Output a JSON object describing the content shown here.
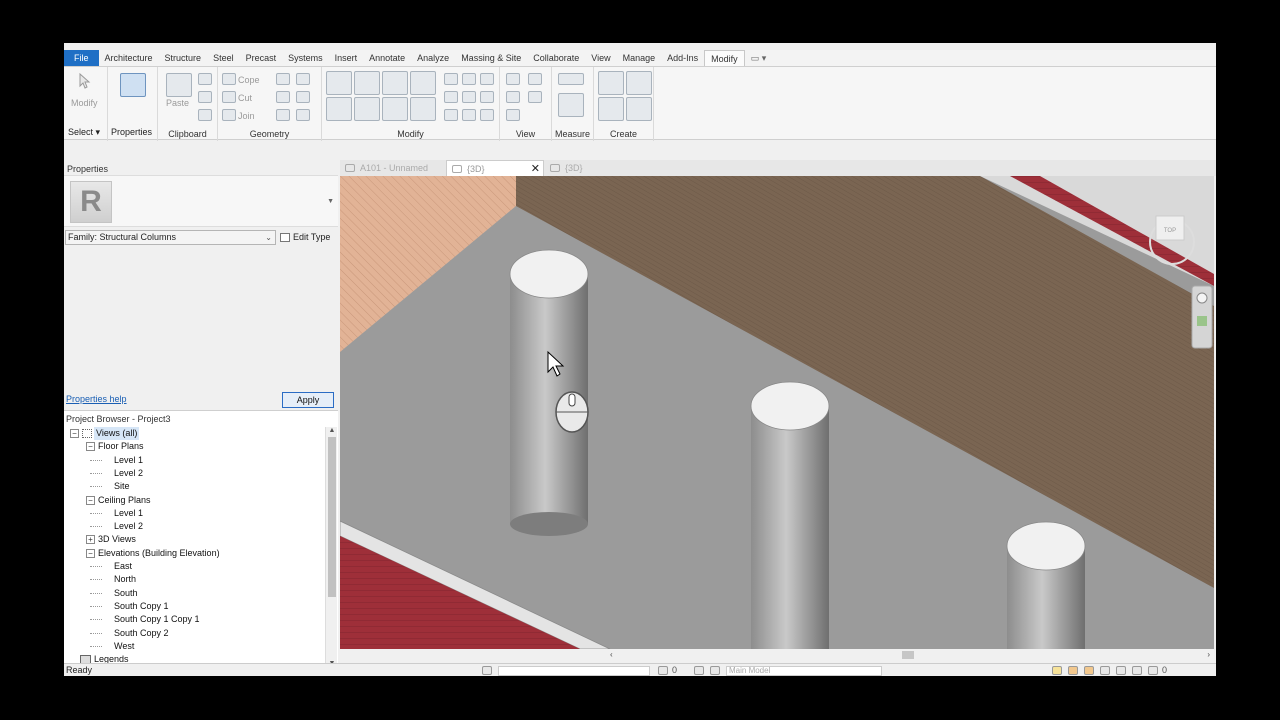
{
  "ribbon_tabs": [
    "File",
    "Architecture",
    "Structure",
    "Steel",
    "Precast",
    "Systems",
    "Insert",
    "Annotate",
    "Analyze",
    "Massing & Site",
    "Collaborate",
    "View",
    "Manage",
    "Add-Ins",
    "Modify"
  ],
  "active_tab": "Modify",
  "ribbon": {
    "select_label": "Select",
    "modify_label": "Modify",
    "properties_label": "Properties",
    "paste_label": "Paste",
    "cope_label": "Cope",
    "cut_label": "Cut",
    "join_label": "Join",
    "groups": {
      "clipboard": "Clipboard",
      "geometry": "Geometry",
      "modify": "Modify",
      "view": "View",
      "measure": "Measure",
      "create": "Create"
    }
  },
  "properties": {
    "title": "Properties",
    "family": "Family: Structural Columns",
    "edit_type": "Edit Type",
    "help_link": "Properties help",
    "apply": "Apply"
  },
  "browser": {
    "title": "Project Browser - Project3",
    "tree": [
      {
        "label": "Views (all)",
        "level": 0,
        "expander": "−",
        "selected": true
      },
      {
        "label": "Floor Plans",
        "level": 1,
        "expander": "−"
      },
      {
        "label": "Level 1",
        "level": 2
      },
      {
        "label": "Level 2",
        "level": 2
      },
      {
        "label": "Site",
        "level": 2
      },
      {
        "label": "Ceiling Plans",
        "level": 1,
        "expander": "−"
      },
      {
        "label": "Level 1",
        "level": 2
      },
      {
        "label": "Level 2",
        "level": 2
      },
      {
        "label": "3D Views",
        "level": 1,
        "expander": "+"
      },
      {
        "label": "Elevations (Building Elevation)",
        "level": 1,
        "expander": "−"
      },
      {
        "label": "East",
        "level": 2
      },
      {
        "label": "North",
        "level": 2
      },
      {
        "label": "South",
        "level": 2
      },
      {
        "label": "South Copy 1",
        "level": 2
      },
      {
        "label": "South Copy 1 Copy 1",
        "level": 2
      },
      {
        "label": "South Copy 2",
        "level": 2
      },
      {
        "label": "West",
        "level": 2
      },
      {
        "label": "Legends",
        "level": 0,
        "expander": ""
      }
    ]
  },
  "view_tabs": [
    {
      "label": "A101 - Unnamed",
      "active": false
    },
    {
      "label": "{3D}",
      "active": true
    },
    {
      "label": "{3D}",
      "active": false
    }
  ],
  "viewcube": {
    "face": "TOP"
  },
  "status": {
    "text": "Ready",
    "counter": "0",
    "model": "Main Model",
    "filter_count": "0"
  },
  "colors": {
    "file_tab": "#1f6fc5",
    "floor": "#9b9b9b",
    "wall_left": "#e6b89a",
    "wall_right": "#7a6552",
    "brick_red": "#b03a45"
  }
}
